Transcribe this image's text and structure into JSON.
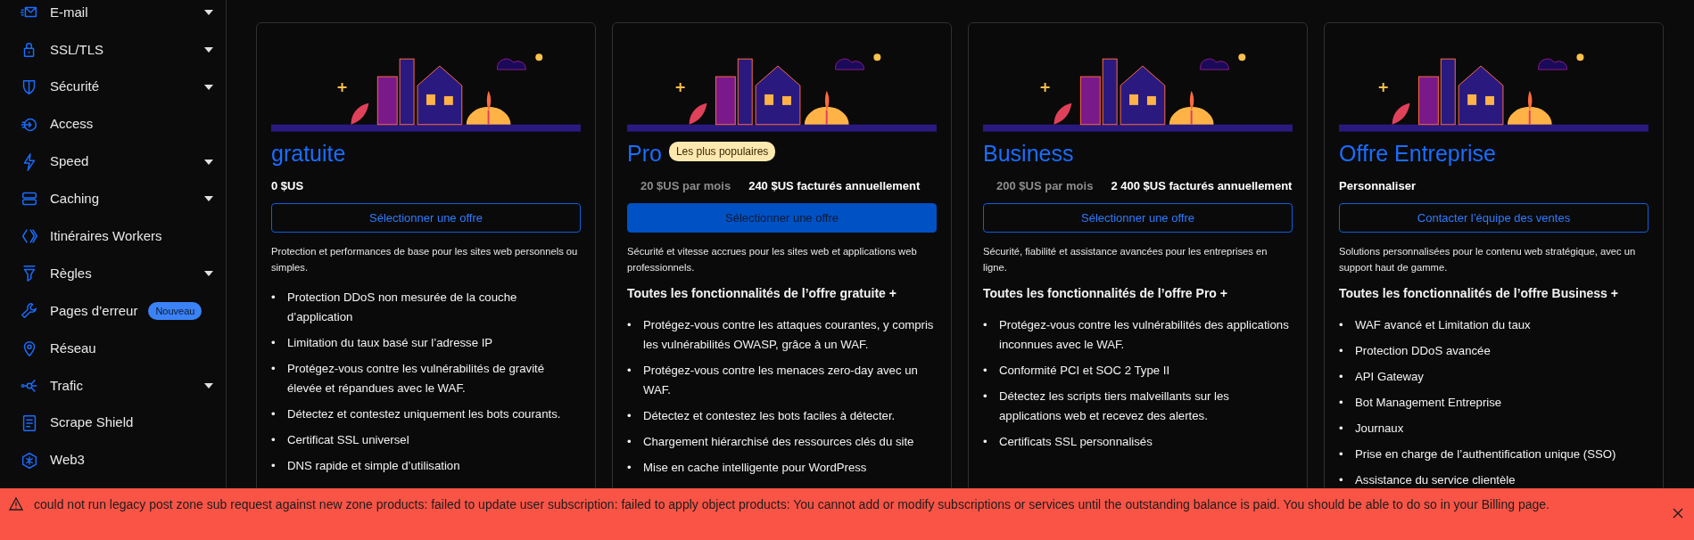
{
  "sidebar": {
    "items": [
      {
        "label": "E-mail",
        "expandable": true
      },
      {
        "label": "SSL/TLS",
        "expandable": true
      },
      {
        "label": "Sécurité",
        "expandable": true
      },
      {
        "label": "Access",
        "expandable": false
      },
      {
        "label": "Speed",
        "expandable": true
      },
      {
        "label": "Caching",
        "expandable": true
      },
      {
        "label": "Itinéraires Workers",
        "expandable": false
      },
      {
        "label": "Règles",
        "expandable": true
      },
      {
        "label": "Pages d’erreur",
        "expandable": false,
        "badge": "Nouveau"
      },
      {
        "label": "Réseau",
        "expandable": false
      },
      {
        "label": "Trafic",
        "expandable": true
      },
      {
        "label": "Scrape Shield",
        "expandable": false
      },
      {
        "label": "Web3",
        "expandable": false
      }
    ]
  },
  "plans": [
    {
      "title": "gratuite",
      "price": "0 $US",
      "button": {
        "label": "Sélectionner une offre",
        "primary": false
      },
      "description": "Protection et performances de base pour les sites web personnels ou simples.",
      "features": [
        {
          "bullet": "•",
          "text": "Protection DDoS non mesurée de la couche d’application"
        },
        {
          "bullet": "•",
          "text": "Limitation du taux basé sur l’adresse IP"
        },
        {
          "bullet": "•",
          "text": "Protégez-vous contre les vulnérabilités de gravité élevée et répandues avec le WAF."
        },
        {
          "bullet": "•",
          "text": "Détectez et contestez uniquement les bots courants."
        },
        {
          "bullet": "•",
          "text": "Certificat SSL universel"
        },
        {
          "bullet": "•",
          "text": "DNS rapide et simple d’utilisation"
        }
      ]
    },
    {
      "title": "Pro",
      "badge": "Les plus populaires",
      "per_month": "20 $US par mois",
      "price": "240 $US facturés annuellement",
      "button": {
        "label": "Sélectionner une offre",
        "primary": true
      },
      "description": "Sécurité et vitesse accrues pour les sites web et applications web professionnels.",
      "features_heading": "Toutes les fonctionnalités de l’offre gratuite +",
      "features": [
        {
          "bullet": "•",
          "text": "Protégez-vous contre les attaques courantes, y compris les vulnérabilités OWASP, grâce à un WAF."
        },
        {
          "bullet": "•",
          "text": "Protégez-vous contre les menaces zero-day avec un WAF."
        },
        {
          "bullet": "•",
          "text": "Détectez et contestez les bots faciles à détecter."
        },
        {
          "bullet": "•",
          "text": "Chargement hiérarchisé des ressources clés du site"
        },
        {
          "bullet": "•",
          "text": "Mise en cache intelligente pour WordPress"
        }
      ]
    },
    {
      "title": "Business",
      "per_month": "200 $US par mois",
      "price": "2 400 $US facturés annuellement",
      "button": {
        "label": "Sélectionner une offre",
        "primary": false
      },
      "description": "Sécurité, fiabilité et assistance avancées pour les entreprises en ligne.",
      "features_heading": "Toutes les fonctionnalités de l’offre Pro +",
      "features": [
        {
          "bullet": "•",
          "text": "Protégez-vous contre les vulnérabilités des applications inconnues avec le WAF."
        },
        {
          "bullet": "•",
          "text": "Conformité PCI et SOC 2 Type II"
        },
        {
          "bullet": "•",
          "text": "Détectez les scripts tiers malveillants sur les applications web et recevez des alertes."
        },
        {
          "bullet": "•",
          "text": "Certificats SSL personnalisés"
        }
      ]
    },
    {
      "title": "Offre Entreprise",
      "price": "Personnaliser",
      "button": {
        "label": "Contacter l’équipe des ventes",
        "primary": false
      },
      "description": "Solutions personnalisées pour le contenu web stratégique, avec un support haut de gamme.",
      "features_heading": "Toutes les fonctionnalités de l’offre Business +",
      "features": [
        {
          "bullet": "•",
          "text": "WAF avancé et Limitation du taux"
        },
        {
          "bullet": "•",
          "text": "Protection DDoS avancée"
        },
        {
          "bullet": "•",
          "text": "API Gateway"
        },
        {
          "bullet": "•",
          "text": "Bot Management Entreprise"
        },
        {
          "bullet": "•",
          "text": "Journaux"
        },
        {
          "bullet": "•",
          "text": "Prise en charge de l’authentification unique (SSO)"
        },
        {
          "bullet": "•",
          "text": "Assistance du service clientèle"
        }
      ]
    }
  ],
  "error_banner": {
    "message": "could not run legacy post zone sub request against new zone products: failed to update user subscription: failed to apply object products: You cannot add or modify subscriptions or services until the outstanding balance is paid. You should be able to do so in your Billing page."
  }
}
